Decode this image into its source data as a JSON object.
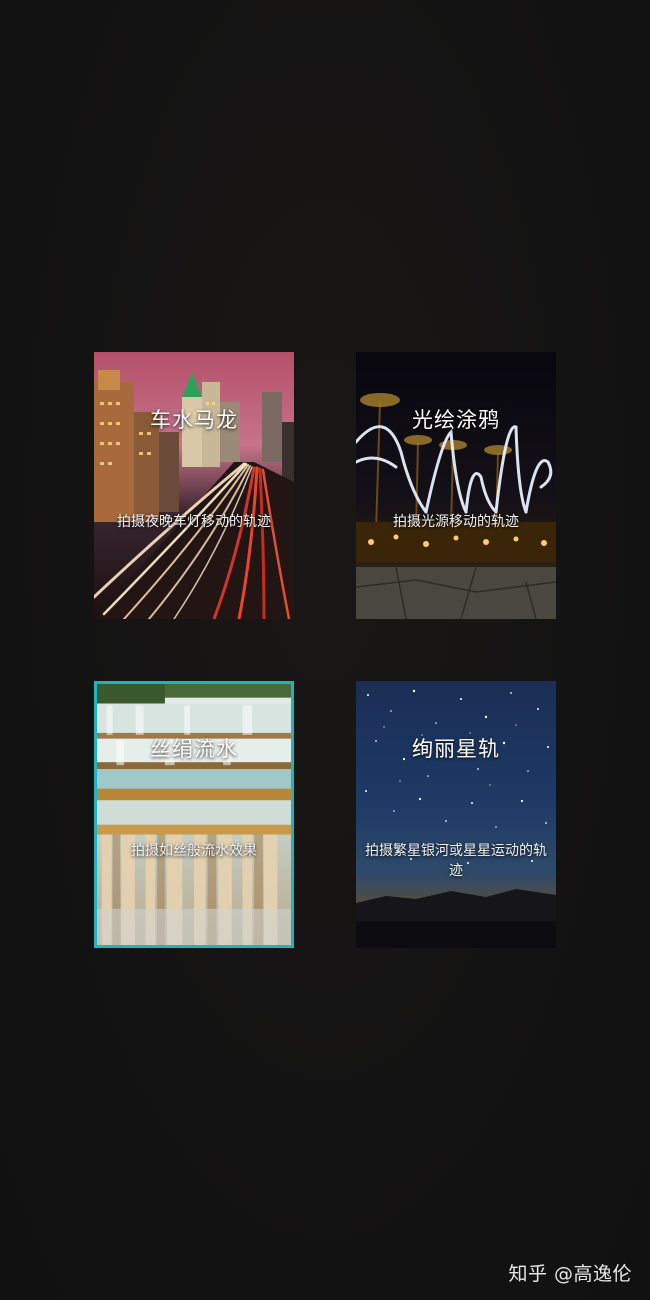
{
  "modes": [
    {
      "id": "traffic",
      "title": "车水马龙",
      "description": "拍摄夜晚车灯移动的轨迹",
      "selected": false
    },
    {
      "id": "light-painting",
      "title": "光绘涂鸦",
      "description": "拍摄光源移动的轨迹",
      "selected": false
    },
    {
      "id": "silky-water",
      "title": "丝绢流水",
      "description": "拍摄如丝般流水效果",
      "selected": true
    },
    {
      "id": "star-trails",
      "title": "绚丽星轨",
      "description": "拍摄繁星银河或星星运动的轨迹",
      "selected": false
    }
  ],
  "watermark": "知乎 @高逸伦",
  "colors": {
    "background": "#121212",
    "selection_border": "#1fb3bf",
    "text": "#ffffff"
  }
}
